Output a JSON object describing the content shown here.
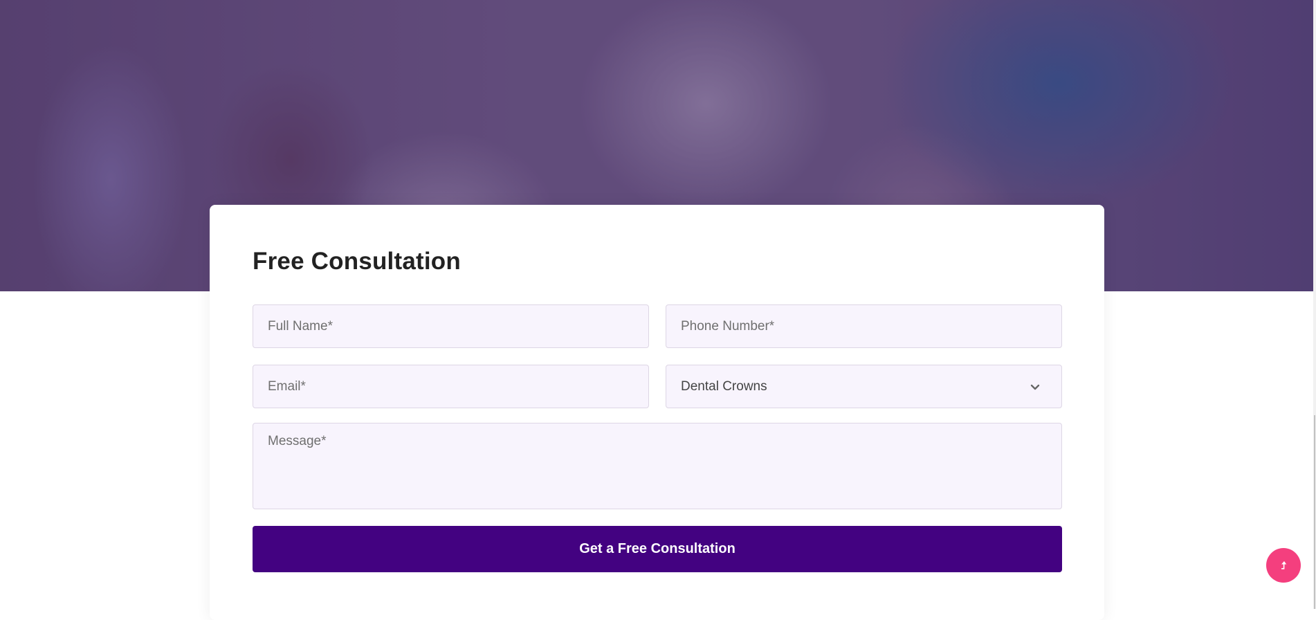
{
  "form": {
    "title": "Free Consultation",
    "full_name_placeholder": "Full Name*",
    "phone_placeholder": "Phone Number*",
    "email_placeholder": "Email*",
    "service_selected": "Dental Crowns",
    "message_placeholder": "Message*",
    "submit_label": "Get a Free Consultation"
  },
  "colors": {
    "button": "#430281",
    "field_bg": "#f8f4fd",
    "scroll_top_button": "#f43f7e"
  },
  "icons": {
    "select": "chevron-down-icon",
    "scroll_top": "arrow-up-icon"
  }
}
